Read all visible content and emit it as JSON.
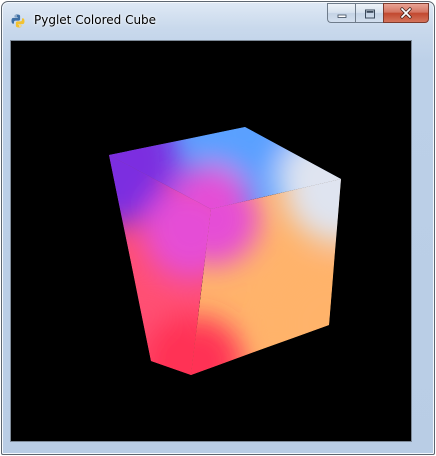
{
  "window": {
    "title": "Pyglet Colored Cube"
  },
  "icons": {
    "app": "python-icon",
    "minimize": "minimize-icon",
    "maximize": "maximize-icon",
    "close": "close-icon"
  },
  "scene": {
    "background": "#000000",
    "face_colors": {
      "top": [
        "#7b2fe0",
        "#5aa0ff",
        "#dfe4f0",
        "#e54ed6"
      ],
      "front": [
        "#7b2fe0",
        "#e54ed6",
        "#ff4f73",
        "#ff3355"
      ],
      "right": [
        "#e54ed6",
        "#dfe4f0",
        "#ffb36b",
        "#ff3355"
      ]
    }
  }
}
